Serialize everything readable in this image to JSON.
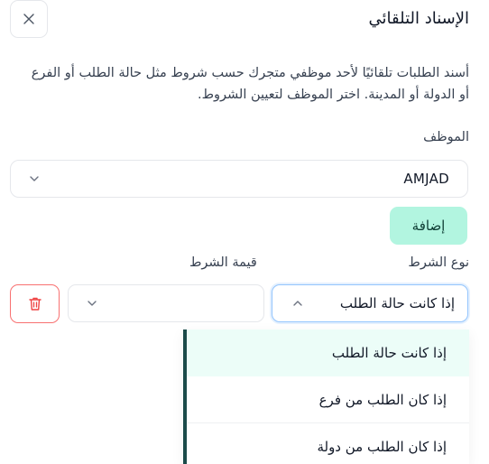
{
  "header": {
    "title": "الإسناد التلقائي",
    "close_icon": "close-icon"
  },
  "description": "أسند الطلبات تلقائيًا لأحد موظفي متجرك حسب شروط مثل حالة الطلب أو الفرع أو الدولة أو المدينة. اختر الموظف لتعيين الشروط.",
  "employee": {
    "label": "الموظف",
    "selected": "AMJAD"
  },
  "add_button": "إضافة",
  "condition": {
    "type_label": "نوع الشرط",
    "value_label": "قيمة الشرط",
    "type_selected": "إذا كانت حالة الطلب",
    "value_selected": ""
  },
  "dropdown": {
    "options": [
      "إذا كانت حالة الطلب",
      "إذا كان الطلب من فرع",
      "إذا كان الطلب من دولة"
    ]
  },
  "colors": {
    "accent": "#b2f5e0",
    "danger": "#f87171",
    "focus": "#93c5fd",
    "dropdown_bar": "#1b4b4a",
    "selected_bg": "#ecfdf8"
  }
}
